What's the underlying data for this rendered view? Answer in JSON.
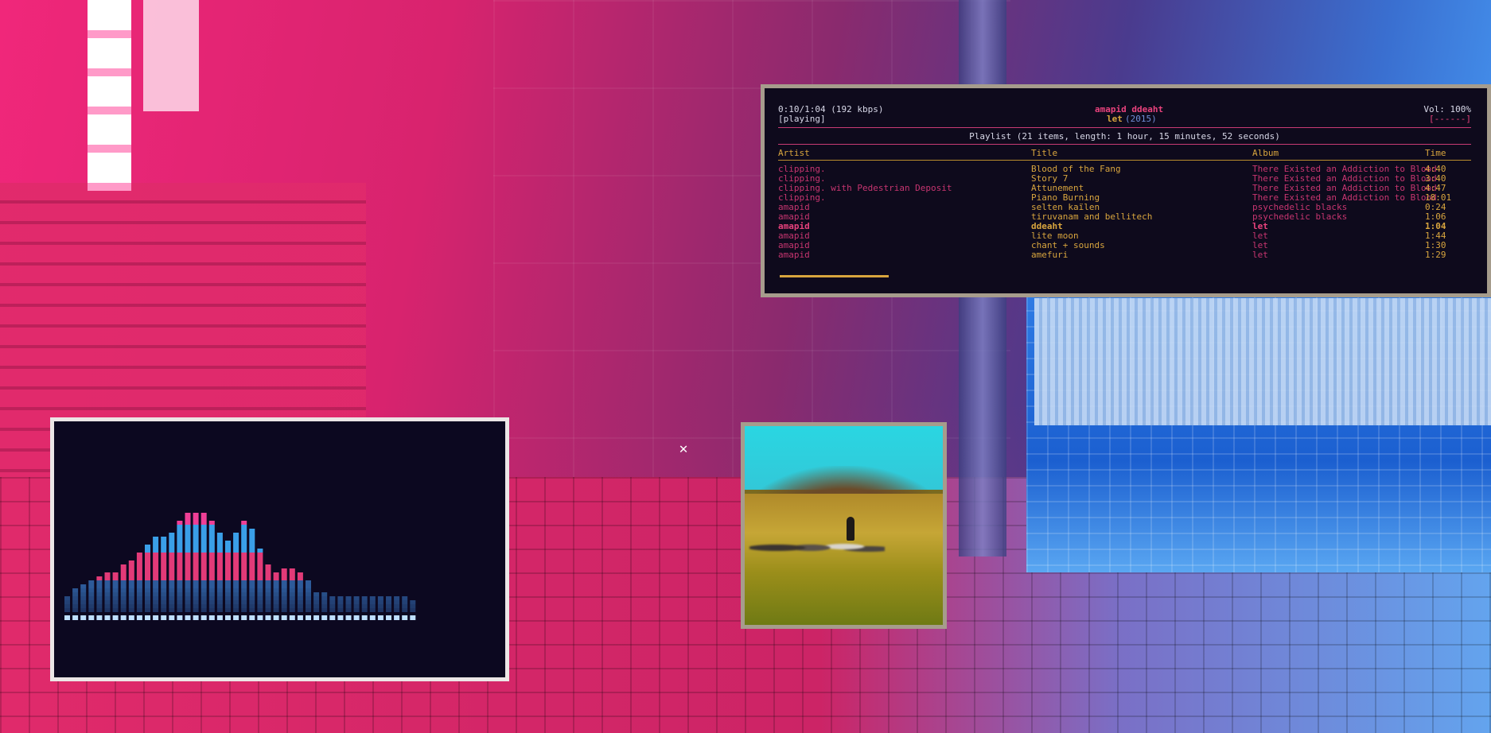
{
  "player": {
    "time": "0:10/1:04 (192 kbps)",
    "state": "[playing]",
    "now_artist": "amapid ddeaht",
    "now_album": "let",
    "now_year": "(2015)",
    "volume": "Vol: 100%",
    "volume_bar": "[------]"
  },
  "playlist": {
    "summary": "Playlist (21 items, length: 1 hour, 15 minutes, 52 seconds)",
    "headers": {
      "artist": "Artist",
      "title": "Title",
      "album": "Album",
      "time": "Time"
    },
    "rows": [
      {
        "artist": "clipping.",
        "title": "Blood of the Fang",
        "album": "There Existed an Addiction to Blood",
        "time": "4:40"
      },
      {
        "artist": "clipping.",
        "title": "Story 7",
        "album": "There Existed an Addiction to Blood",
        "time": "3:40"
      },
      {
        "artist": "clipping. with Pedestrian Deposit",
        "title": "Attunement",
        "album": "There Existed an Addiction to Blood",
        "time": "4:47"
      },
      {
        "artist": "clipping.",
        "title": "Piano Burning",
        "album": "There Existed an Addiction to Blood",
        "time": "18:01"
      },
      {
        "artist": "amapid",
        "title": "selten kaïlen",
        "album": "psychedelic blacks",
        "time": "0:24"
      },
      {
        "artist": "amapid",
        "title": "tiruvanam and bellitech",
        "album": "psychedelic blacks",
        "time": "1:06"
      },
      {
        "artist": "amapid",
        "title": "ddeaht",
        "album": "let",
        "time": "1:04"
      },
      {
        "artist": "amapid",
        "title": "lite moon",
        "album": "let",
        "time": "1:44"
      },
      {
        "artist": "amapid",
        "title": "chant + sounds",
        "album": "let",
        "time": "1:30"
      },
      {
        "artist": "amapid",
        "title": "amefuri",
        "album": "let",
        "time": "1:29"
      }
    ],
    "current_index": 6,
    "progress_fraction": 0.156
  },
  "visualizer": {
    "levels": [
      4,
      6,
      7,
      8,
      9,
      10,
      10,
      12,
      13,
      15,
      17,
      19,
      19,
      20,
      23,
      25,
      25,
      25,
      23,
      20,
      18,
      20,
      23,
      21,
      16,
      12,
      10,
      11,
      11,
      10,
      8,
      5,
      5,
      4,
      4,
      4,
      4,
      4,
      4,
      4,
      4,
      4,
      4,
      3
    ],
    "colors": {
      "top": "#ef3f96",
      "mid": "#3a9fe8",
      "pink_band": "#e23a78",
      "low": "#2d5a9a",
      "base": "#bfe0ff"
    }
  },
  "colors": {
    "accent_pink": "#e9427d",
    "accent_gold": "#d8a53e",
    "terminal_bg": "#0e0a1c"
  }
}
